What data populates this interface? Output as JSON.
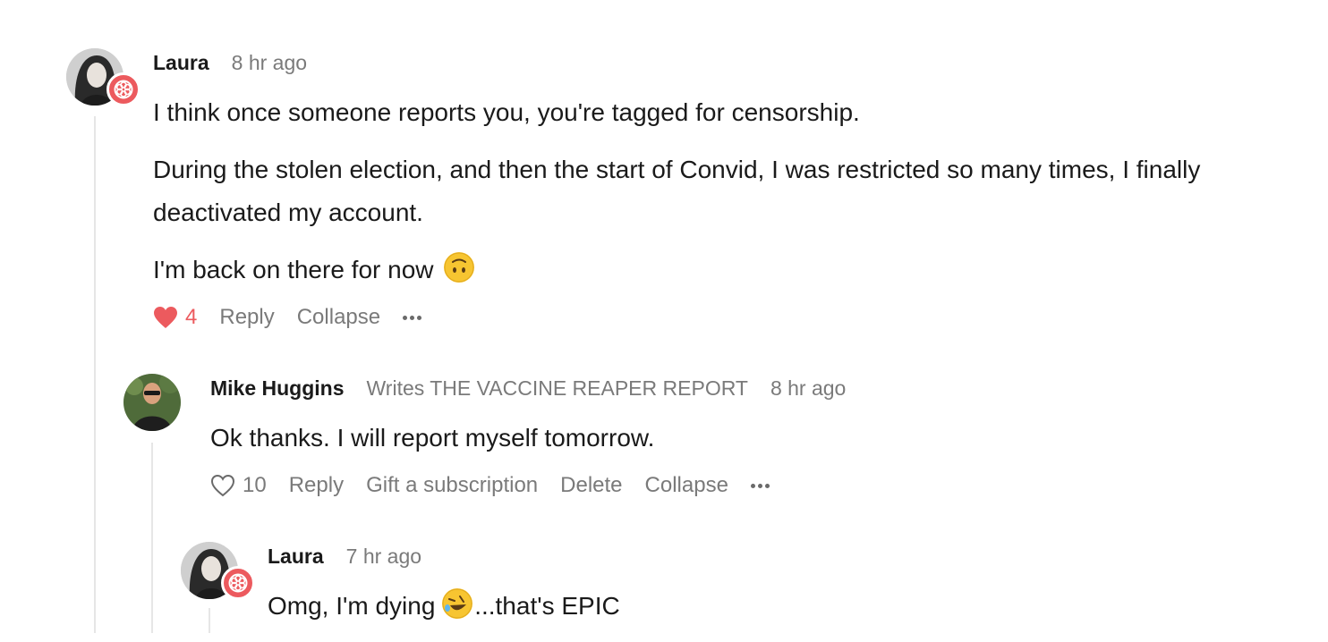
{
  "comments": [
    {
      "author": "Laura",
      "time": "8 hr ago",
      "paragraphs": [
        "I think once someone reports you, you're tagged for censorship.",
        "During the stolen election, and then the start of Convid, I was restricted so many times, I finally deactivated my account.",
        "I'm back on there for now"
      ],
      "emoji_name": "upside-down-face-emoji",
      "likes": "4",
      "liked": true,
      "actions": [
        "Reply",
        "Collapse"
      ],
      "badge_color": "#ec5a5e"
    },
    {
      "author": "Mike Huggins",
      "byline": "Writes THE VACCINE REAPER REPORT",
      "time": "8 hr ago",
      "paragraphs": [
        "Ok thanks. I will report myself tomorrow."
      ],
      "likes": "10",
      "liked": false,
      "actions": [
        "Reply",
        "Gift a subscription",
        "Delete",
        "Collapse"
      ]
    },
    {
      "author": "Laura",
      "time": "7 hr ago",
      "text_before_emoji": "Omg, I'm dying ",
      "emoji_name": "rolling-on-floor-laughing-emoji",
      "text_after_emoji": "...that's EPIC"
    }
  ],
  "colors": {
    "accent": "#ec5a5e",
    "muted": "#7a7a7a",
    "thread": "#e6e6e6"
  }
}
